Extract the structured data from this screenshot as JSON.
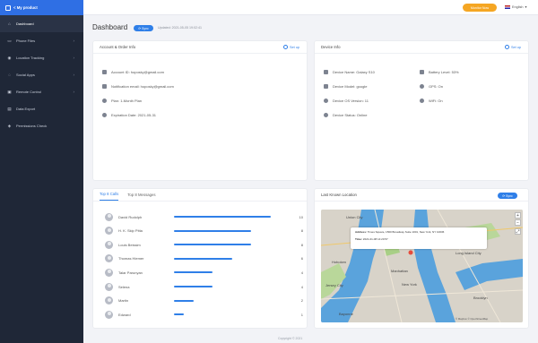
{
  "sidebar": {
    "product": "< My product",
    "items": [
      {
        "label": "Dashboard",
        "icon": "home-icon",
        "active": true
      },
      {
        "label": "Phone Files",
        "icon": "folder-icon",
        "chevron": true
      },
      {
        "label": "Location Tracking",
        "icon": "location-pin-icon",
        "chevron": true
      },
      {
        "label": "Social Apps",
        "icon": "chat-bubble-icon",
        "chevron": true
      },
      {
        "label": "Remote Control",
        "icon": "remote-control-icon",
        "chevron": true
      },
      {
        "label": "Data Export",
        "icon": "export-icon"
      },
      {
        "label": "Permissions Check",
        "icon": "shield-check-icon"
      }
    ]
  },
  "topbar": {
    "monitor_button": "Monitor Now",
    "language": "English"
  },
  "header": {
    "title": "Dashboard",
    "sync_label": "Sync",
    "updated": "Updated: 2021-05-05 19:02:41"
  },
  "account_card": {
    "title": "Account & Order Info",
    "setup": "Set up",
    "rows": [
      {
        "icon": "user-id-icon",
        "text": "Account ID: hoposky@gmail.com"
      },
      {
        "icon": "email-icon",
        "text": "Notification email: hoposky@gmail.com"
      },
      {
        "icon": "plan-icon",
        "text": "Plan: 1-Month Plan"
      },
      {
        "icon": "clock-icon",
        "text": "Expiration Date: 2021-05-31"
      }
    ]
  },
  "device_card": {
    "title": "Device Info",
    "setup": "Set up",
    "left_rows": [
      {
        "icon": "phone-icon",
        "text": "Device Name: Galaxy S10"
      },
      {
        "icon": "phone-icon",
        "text": "Device Model: google"
      },
      {
        "icon": "settings-icon",
        "text": "Device OS Version: 11"
      },
      {
        "icon": "status-icon",
        "text": "Device Status: Online"
      }
    ],
    "right_rows": [
      {
        "icon": "battery-icon",
        "text": "Battery Level: 53%"
      },
      {
        "icon": "gps-icon",
        "text": "GPS: On"
      },
      {
        "icon": "wifi-icon",
        "text": "WiFi: On"
      }
    ]
  },
  "calls_card": {
    "tabs": [
      "Top 8 Calls",
      "Top 8 Messages"
    ],
    "active_tab": 0,
    "rows": [
      {
        "name": "David Rudolph",
        "count": 10
      },
      {
        "name": "H. K. Skip Pitta",
        "count": 8
      },
      {
        "name": "Louis Beissim",
        "count": 8
      },
      {
        "name": "Thomas Hiemer",
        "count": 6
      },
      {
        "name": "Talar Parunyan",
        "count": 4
      },
      {
        "name": "Selena",
        "count": 4
      },
      {
        "name": "Martin",
        "count": 2
      },
      {
        "name": "Edward",
        "count": 1
      }
    ]
  },
  "location_card": {
    "title": "Last Known Location",
    "sync_label": "Sync",
    "popup_address_label": "Address:",
    "popup_address": "Times Square, 1560 Broadway Suite 1001, New York, NY 10036",
    "popup_time_label": "Time:",
    "popup_time": "2021-01-08 14:20:57",
    "map_labels": [
      "Union City",
      "Hoboken",
      "Manhattan",
      "Jersey City",
      "Bayonne",
      "Long Island City",
      "Brooklyn",
      "New York"
    ],
    "map_attribution": "© Mapbox © OpenStreetMap",
    "zoom_in": "+",
    "zoom_out": "−"
  },
  "footer": "Copyright © 2021"
}
